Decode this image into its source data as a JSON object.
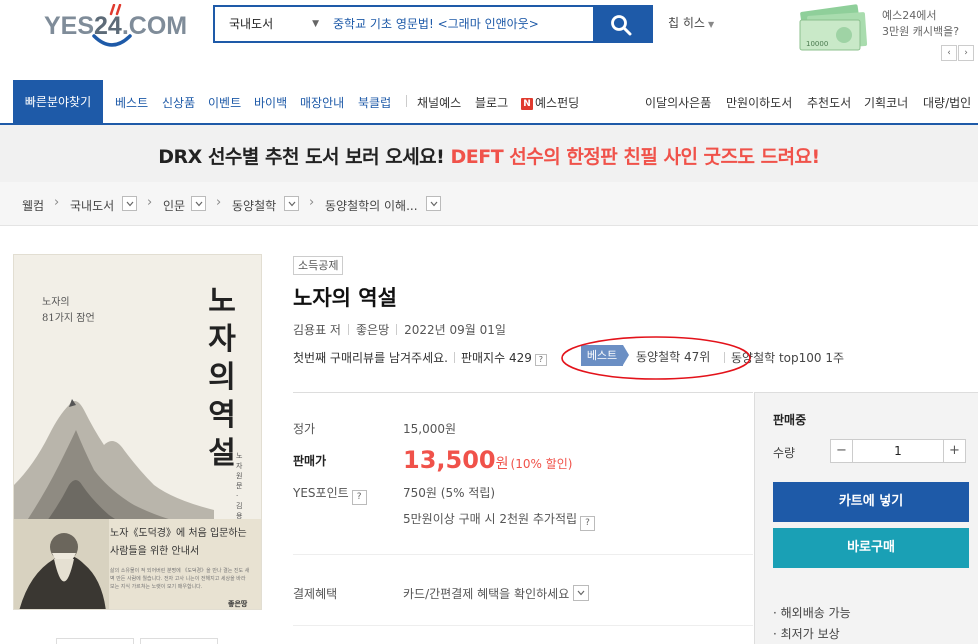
{
  "header": {
    "logo_left": "YES",
    "logo_num": "24",
    "logo_right": ".COM",
    "search_category": "국내도서",
    "search_query": "중학교 기초 영문법! <그래마 인앤아웃>",
    "user_name": "칩 히스",
    "promo_line1": "예스24에서",
    "promo_line2": "3만원 캐시백을?",
    "promo_prev": "‹",
    "promo_next": "›"
  },
  "nav": {
    "quick": "빠른분야찾기",
    "left_items": [
      "베스트",
      "신상품",
      "이벤트",
      "바이백",
      "매장안내",
      "북클럽"
    ],
    "mid_items": [
      "채널예스",
      "블로그",
      "예스펀딩"
    ],
    "funding_icon": "N",
    "right_items": [
      "이달의사은품",
      "만원이하도서",
      "추천도서",
      "기획코너",
      "대량/법인"
    ]
  },
  "banner": {
    "black": "DRX 선수별 추천 도서 보러 오세요!",
    "red": "DEFT 선수의 한정판 친필 사인 굿즈도 드려요!"
  },
  "breadcrumb": [
    "웰컴",
    "국내도서",
    "인문",
    "동양철학",
    "동양철학의 이해..."
  ],
  "cover": {
    "subtitle_1": "노자의",
    "subtitle_2": "81가지 잠언",
    "title_vertical": [
      "노",
      "자",
      "의",
      "역",
      "설"
    ],
    "author_vertical": "노자 원문 · 김용표 풀이",
    "band_line1": "노자《도덕경》에 처음 입문하는",
    "band_line2": "사람들을 위한 안내서",
    "band_small": "삶의 소유물이 적 되어버린 분명에 《도덕경》을 만나 결는 진도 새벽 만든 사람에 뭘습니다. 전자 고사 니는이 전해지고 세상을 바라보는 지식 가르쳐는 노랫이 모기 매우합니다.",
    "publisher": "좋은땅"
  },
  "book": {
    "tag": "소득공제",
    "title": "노자의 역설",
    "author": "김용표 저",
    "publisher": "좋은땅",
    "date": "2022년 09월 01일",
    "review_prompt": "첫번째 구매리뷰를 남겨주세요.",
    "sales_index": "판매지수 429",
    "help": "?",
    "best_badge": "베스트",
    "best_rank": "동양철학 47위",
    "top100": "동양철학 top100 1주"
  },
  "price": {
    "list_label": "정가",
    "list_value": "15,000원",
    "sale_label": "판매가",
    "sale_num": "13,500",
    "sale_won": "원",
    "discount": "(10% 할인)",
    "point_label": "YES포인트",
    "point_value": "750원 (5% 적립)",
    "point_extra": "5만원이상 구매 시 2천원 추가적립",
    "pay_label": "결제혜택",
    "pay_value": "카드/간편결제 혜택을 확인하세요"
  },
  "purchase": {
    "status": "판매중",
    "qty_label": "수량",
    "qty_value": "1",
    "minus": "−",
    "plus": "+",
    "cart": "카트에 넣기",
    "buy": "바로구매",
    "benefit1": "· 해외배송 가능",
    "benefit2": "· 최저가 보상"
  },
  "colors": {
    "brand_blue": "#1e5aa8",
    "sale_red": "#f0524a",
    "buy_teal": "#1aa0b5",
    "annotation_red": "#e3121a"
  }
}
